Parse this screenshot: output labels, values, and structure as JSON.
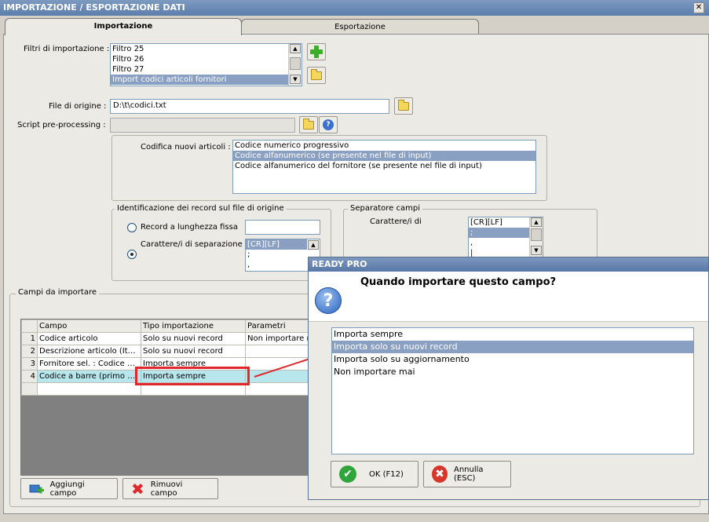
{
  "window": {
    "title": "IMPORTAZIONE / ESPORTAZIONE DATI",
    "close_glyph": "✕"
  },
  "tabs": [
    {
      "label": "Importazione"
    },
    {
      "label": "Esportazione"
    }
  ],
  "filters": {
    "label": "Filtri di importazione :",
    "items": [
      "Filtro 25",
      "Filtro 26",
      "Filtro 27",
      "Import codici articoli fornitori"
    ],
    "selected_index": 3
  },
  "file_origin": {
    "label": "File di origine :",
    "value": "D:\\t\\codici.txt"
  },
  "script_pre": {
    "label": "Script pre-processing :",
    "value": "",
    "help_glyph": "?"
  },
  "codifica": {
    "label": "Codifica nuovi articoli :",
    "items": [
      "Codice numerico progressivo",
      "Codice alfanumerico (se presente nel file di input)",
      "Codice alfanumerico del fornitore (se presente nel file di input)"
    ],
    "selected_index": 1
  },
  "identification": {
    "title": "Identificazione dei record sul file di origine",
    "option_fixed": "Record a lunghezza fissa",
    "option_sep": "Carattere/i di separazione",
    "separators": [
      "[CR][LF]",
      ";",
      ","
    ]
  },
  "separatore": {
    "title": "Separatore campi",
    "label": "Carattere/i di",
    "items": [
      "[CR][LF]",
      ";",
      ",",
      "|"
    ],
    "selected_index": 1
  },
  "campi": {
    "title": "Campi da importare",
    "columns": [
      "Campo",
      "Tipo importazione",
      "Parametri"
    ],
    "rows": [
      {
        "n": "1",
        "campo": "Codice articolo",
        "tipo": "Solo su nuovi record",
        "param": "Non importare ri"
      },
      {
        "n": "2",
        "campo": "Descrizione articolo (Ital...",
        "tipo": "Solo su nuovi record",
        "param": ""
      },
      {
        "n": "3",
        "campo": "Fornitore sel. : Codice a...",
        "tipo": "Importa sempre",
        "param": ""
      },
      {
        "n": "4",
        "campo": "Codice a barre (primo c...",
        "tipo": "Importa sempre",
        "param": ""
      }
    ],
    "add_button": "Aggiungi campo",
    "remove_button": "Rimuovi campo"
  },
  "dialog": {
    "title": "READY PRO",
    "question": "Quando importare questo campo?",
    "icon_glyph": "?",
    "options": [
      "Importa sempre",
      "Importa solo su nuovi record",
      "Importa solo su aggiornamento",
      "Non importare mai"
    ],
    "selected_index": 1,
    "ok_button": "OK (F12)",
    "cancel_button": "Annulla (ESC)",
    "ok_glyph": "✔",
    "cancel_glyph": "✖"
  },
  "colors": {
    "highlight": "#8aa0c2",
    "annotation": "#e0282c",
    "row_selected": "#b7e6ec"
  }
}
